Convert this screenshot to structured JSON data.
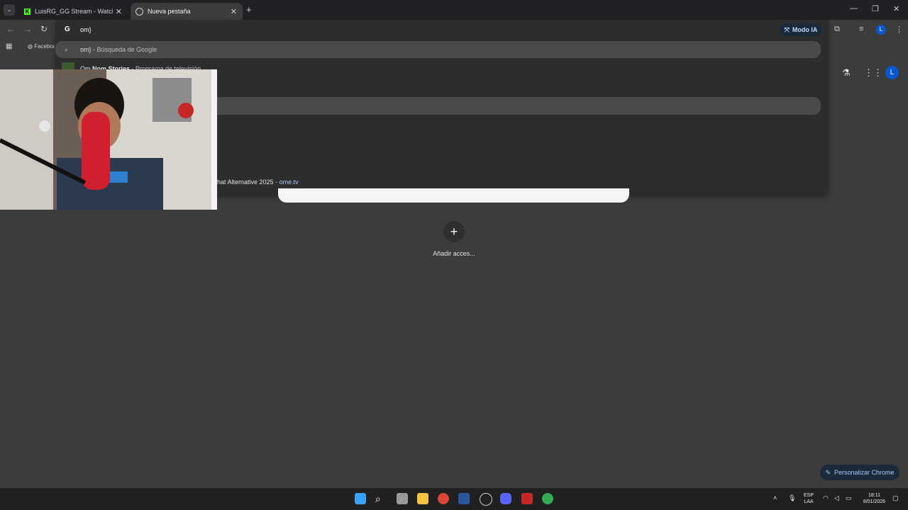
{
  "tabs": [
    {
      "title": "LuisRG_GG Stream - Watch Live",
      "active": false
    },
    {
      "title": "Nueva pestaña",
      "active": true
    }
  ],
  "window_controls": {
    "minimize": "—",
    "restore": "❐",
    "close": "✕"
  },
  "toolbar": {
    "omnibox_value": "om}",
    "ai_mode_label": "Modo IA",
    "profile_initial": "L"
  },
  "bookmarks": {
    "first": "Facebook"
  },
  "suggestions": [
    {
      "text": "om}",
      "suffix": " - Búsqueda de Google"
    },
    {
      "text_plain": "Om ",
      "text_bold": "Nom Stories",
      "suffix": " - Programa de televisión"
    },
    {
      "prefix": "hat Alternative 2025",
      "sep": " - ",
      "domain": "ome.tv"
    }
  ],
  "ntp": {
    "add_shortcut_label": "Añadir acces...",
    "customize_label": "Personalizar Chrome",
    "profile_initial": "L"
  },
  "taskbar": {
    "lang_line1": "ESP",
    "lang_line2": "LAA",
    "time": "18:11",
    "date": "8/01/2026"
  },
  "colors": {
    "accent": "#a8c7fa",
    "page_bg": "#3c3c3c",
    "profile": "#0b57d0"
  }
}
